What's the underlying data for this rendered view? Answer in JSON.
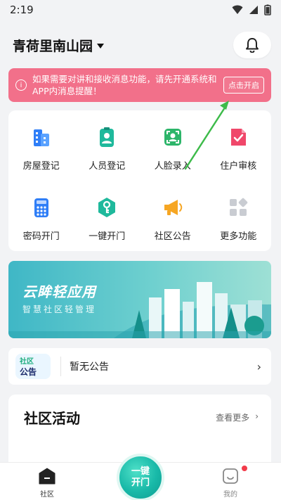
{
  "status_bar": {
    "time": "2:19"
  },
  "header": {
    "community_name": "青荷里南山园"
  },
  "notice": {
    "text": "如果需要对讲和接收消息功能，请先开通系统和APP内消息提醒！",
    "button_label": "点击开启",
    "info_glyph": "i"
  },
  "grid": [
    {
      "label": "房屋登记",
      "icon": "building-icon",
      "color": "#2f7ef7"
    },
    {
      "label": "人员登记",
      "icon": "id-badge-icon",
      "color": "#1fb99c"
    },
    {
      "label": "人脸录入",
      "icon": "face-scan-icon",
      "color": "#2db56a"
    },
    {
      "label": "住户审核",
      "icon": "document-check-icon",
      "color": "#f0476a"
    },
    {
      "label": "密码开门",
      "icon": "keypad-icon",
      "color": "#2f7ef7"
    },
    {
      "label": "一键开门",
      "icon": "key-icon",
      "color": "#1fb99c"
    },
    {
      "label": "社区公告",
      "icon": "megaphone-icon",
      "color": "#f6a623"
    },
    {
      "label": "更多功能",
      "icon": "apps-icon",
      "color": "#c9ccd2"
    }
  ],
  "promo": {
    "title": "云眸轻应用",
    "subtitle": "智慧社区轻管理"
  },
  "announcement": {
    "tag_top": "社区",
    "tag_bottom": "公告",
    "text": "暂无公告",
    "chevron": "›"
  },
  "activity": {
    "title": "社区活动",
    "more_label": "查看更多",
    "more_chevron": "›"
  },
  "bottom_nav": {
    "home_label": "社区",
    "center_line1": "一键",
    "center_line2": "开门",
    "me_label": "我的"
  },
  "colors": {
    "notice_bg": "#f2708a",
    "accent_green": "#18b9a8",
    "annotation_arrow": "#3dbb4a"
  }
}
